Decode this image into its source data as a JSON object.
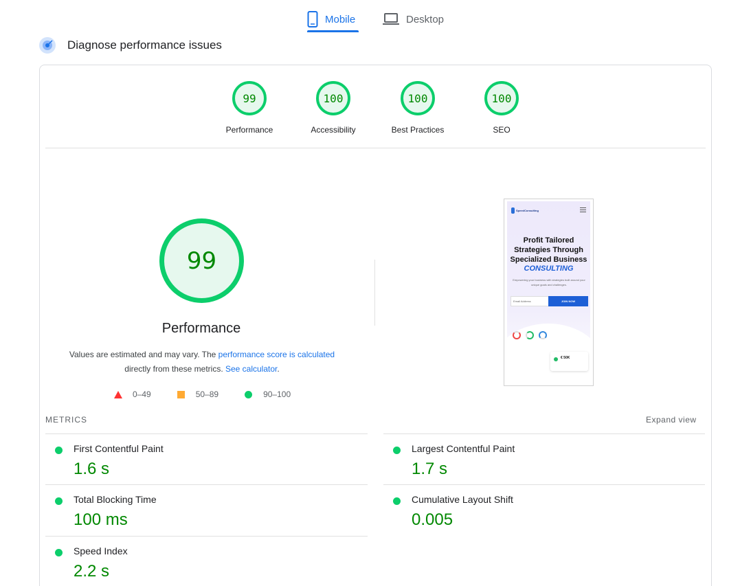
{
  "tabs": [
    {
      "label": "Mobile",
      "icon": "phone-icon",
      "active": true
    },
    {
      "label": "Desktop",
      "icon": "laptop-icon",
      "active": false
    }
  ],
  "header": {
    "title": "Diagnose performance issues",
    "icon": "diagnose-icon"
  },
  "categories": [
    {
      "label": "Performance",
      "score": "99"
    },
    {
      "label": "Accessibility",
      "score": "100"
    },
    {
      "label": "Best Practices",
      "score": "100"
    },
    {
      "label": "SEO",
      "score": "100"
    }
  ],
  "summary": {
    "score": "99",
    "title": "Performance",
    "note_prefix": "Values are estimated and may vary. The ",
    "note_link": "performance score is calculated",
    "note_mid": " directly from these metrics. ",
    "note_link2": "See calculator",
    "note_end": "."
  },
  "legend": [
    {
      "label": "0–49",
      "color": "#ff3333",
      "shape": "triangle"
    },
    {
      "label": "50–89",
      "color": "#ffaa33",
      "shape": "square"
    },
    {
      "label": "90–100",
      "color": "#0cce6b",
      "shape": "circle"
    }
  ],
  "screenshot": {
    "logo": "SpeedConsulting",
    "headline": "Profit Tailored Strategies Through Specialized Business",
    "headline_accent": "CONSULTING",
    "subtext": "Empowering your business with strategies built around your unique goals and challenges.",
    "email_placeholder": "Email Address",
    "join_button": "JOIN NOW",
    "badge_text": "€ 50K"
  },
  "metrics": {
    "label": "METRICS",
    "expand_label": "Expand view",
    "items": [
      {
        "name": "First Contentful Paint",
        "value": "1.6 s",
        "status": "good"
      },
      {
        "name": "Largest Contentful Paint",
        "value": "1.7 s",
        "status": "good"
      },
      {
        "name": "Total Blocking Time",
        "value": "100 ms",
        "status": "good"
      },
      {
        "name": "Cumulative Layout Shift",
        "value": "0.005",
        "status": "good"
      },
      {
        "name": "Speed Index",
        "value": "2.2 s",
        "status": "good"
      }
    ]
  },
  "colors": {
    "accent": "#1a73e8",
    "pass": "#0cce6b",
    "pass_text": "#008800"
  }
}
